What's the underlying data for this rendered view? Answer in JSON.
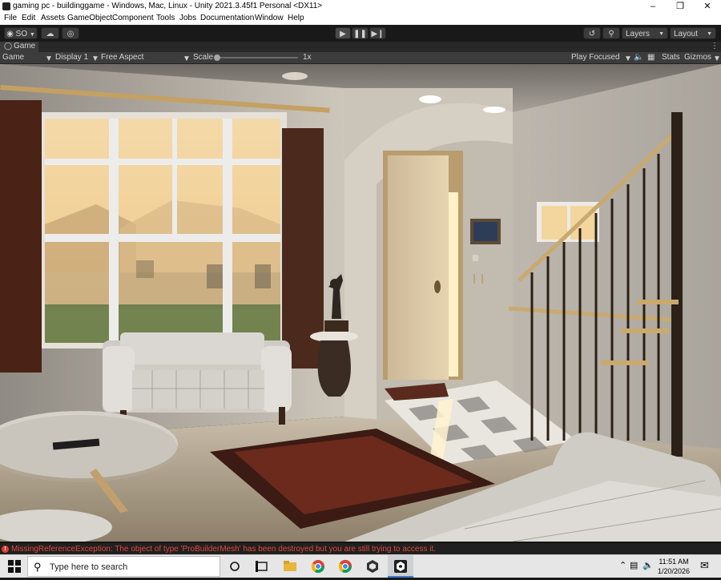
{
  "window": {
    "title": "gaming pc - buildinggame - Windows, Mac, Linux - Unity 2021.3.45f1 Personal <DX11>",
    "controls": [
      "–",
      "❐",
      "✕"
    ]
  },
  "menu": [
    "File",
    "Edit",
    "Assets",
    "GameObject",
    "Component",
    "Tools",
    "Jobs",
    "Documentation",
    "Window",
    "Help"
  ],
  "toolbar": {
    "account": "SO",
    "layers": "Layers",
    "layout": "Layout"
  },
  "game_tab": {
    "label": "Game",
    "more": "⋮"
  },
  "game_bar": {
    "mode": "Game",
    "display": "Display 1",
    "aspect": "Free Aspect",
    "scale_label": "Scale",
    "scale_value": "1x",
    "play_mode": "Play Focused",
    "stats": "Stats",
    "gizmos": "Gizmos"
  },
  "status": {
    "error_message": "MissingReferenceException: The object of type 'ProBuilderMesh' has been destroyed but you are still trying to access it."
  },
  "taskbar": {
    "search_placeholder": "Type here to search",
    "time": "11:51 AM",
    "date": "1/20/2026"
  },
  "colors": {
    "editor_bg": "#191919",
    "error_red": "#e24a3c",
    "taskbar_bg": "#e6e6e6"
  }
}
